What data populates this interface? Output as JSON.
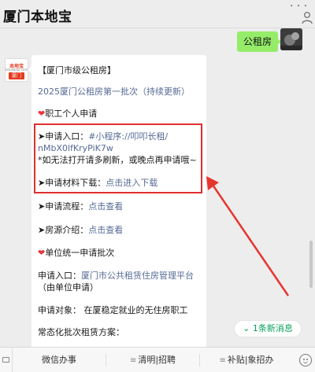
{
  "header": {
    "title": "厦门本地宝",
    "more_icon": "more-dots-icon",
    "profile_icon": "user-icon"
  },
  "chat": {
    "outgoing": {
      "text": "公租房"
    },
    "bot_avatar": {
      "brand": "本地宝",
      "site": "bendibao.com",
      "city": "厦门"
    },
    "lines": [
      {
        "text": "【厦门市级公租房】"
      },
      {
        "text": "2025厦门公租房第一批次（持续更新）"
      },
      {
        "text": "职工个人申请"
      },
      {
        "label": "➤申请入口：",
        "link": "#小程序://叩叩长租/"
      },
      {
        "text": "nMbX0lfKryPiK7w"
      },
      {
        "text": "*如无法打开请多刷新，或晚点再申请哦~"
      },
      {
        "label": "➤申请材料下载：",
        "link": "点击进入下载"
      },
      {
        "label": "➤申请流程：",
        "link": "点击查看"
      },
      {
        "label": "➤房源介绍：",
        "link": "点击查看"
      },
      {
        "text": "单位统一申请批次"
      },
      {
        "label": "申请入口：",
        "link": "厦门市公共租赁住房管理平台"
      },
      {
        "text": "（由单位申请）"
      },
      {
        "text": "申请对象：  在厦稳定就业的无住房职工"
      },
      {
        "text": "常态化批次租赁方案："
      }
    ],
    "new_messages": "1条新消息"
  },
  "bottom_menu": {
    "items": [
      {
        "label": "微信办事"
      },
      {
        "label": "清明|招聘"
      },
      {
        "label": "补贴|象招办"
      }
    ]
  },
  "colors": {
    "link": "#576b95",
    "highlight_box": "#e02e2e",
    "outgoing_bubble": "#95ec69",
    "new_message_text": "#07a15a"
  }
}
